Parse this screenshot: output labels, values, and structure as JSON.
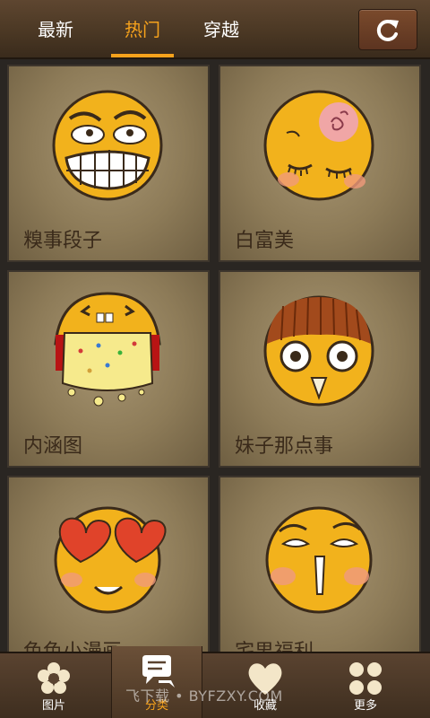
{
  "tabs": [
    {
      "label": "最新"
    },
    {
      "label": "热门"
    },
    {
      "label": "穿越"
    }
  ],
  "active_tab": "热门",
  "refresh_icon": "refresh-icon",
  "categories": [
    {
      "label": "糗事段子",
      "icon": "grimace-face-icon"
    },
    {
      "label": "白富美",
      "icon": "sleeping-blush-face-icon"
    },
    {
      "label": "内涵图",
      "icon": "crumbling-face-icon"
    },
    {
      "label": "妹子那点事",
      "icon": "shocked-face-icon"
    },
    {
      "label": "色色小漫画",
      "icon": "heart-eyes-face-icon"
    },
    {
      "label": "宅男福利",
      "icon": "smug-blush-face-icon"
    }
  ],
  "nav": [
    {
      "label": "图片",
      "icon": "flower-icon"
    },
    {
      "label": "分类",
      "icon": "chat-bubble-icon"
    },
    {
      "label": "收藏",
      "icon": "heart-icon"
    },
    {
      "label": "更多",
      "icon": "four-dots-icon"
    }
  ],
  "active_nav": "分类",
  "watermark": "飞下载 • BYFZXY.COM",
  "colors": {
    "accent": "#f6a21c",
    "face": "#f2b21c",
    "card": "#a89672"
  }
}
